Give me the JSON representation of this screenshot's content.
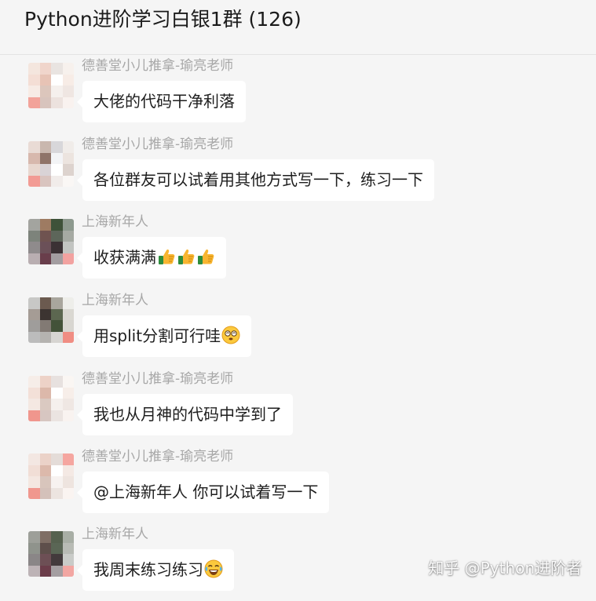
{
  "chat": {
    "title": "Python进阶学习白银1群 (126)"
  },
  "messages": [
    {
      "sender": "德善堂小儿推拿-瑜亮老师",
      "text": "大佬的代码干净利落",
      "emojis": []
    },
    {
      "sender": "德善堂小儿推拿-瑜亮老师",
      "text": "各位群友可以试着用其他方式写一下，练习一下",
      "emojis": []
    },
    {
      "sender": "上海新年人",
      "text": "收获满满",
      "emojis": [
        "thumbs-up-icon",
        "thumbs-up-icon",
        "thumbs-up-icon"
      ]
    },
    {
      "sender": "上海新年人",
      "text": "用split分割可行哇",
      "emojis": [
        "dazed-face-icon"
      ]
    },
    {
      "sender": "德善堂小儿推拿-瑜亮老师",
      "text": "我也从月神的代码中学到了",
      "emojis": []
    },
    {
      "sender": "德善堂小儿推拿-瑜亮老师",
      "text": "@上海新年人 你可以试着写一下",
      "emojis": []
    },
    {
      "sender": "上海新年人",
      "text": "我周末练习练习",
      "emojis": [
        "laughing-tears-icon"
      ]
    }
  ],
  "watermark": {
    "text": "知乎 @Python进阶者"
  },
  "colors": {
    "background": "#f5f5f5",
    "bubble": "#ffffff",
    "sender_name": "#a7a7a7",
    "message_text": "#1e1e1e",
    "title_text": "#1b1b1b"
  }
}
